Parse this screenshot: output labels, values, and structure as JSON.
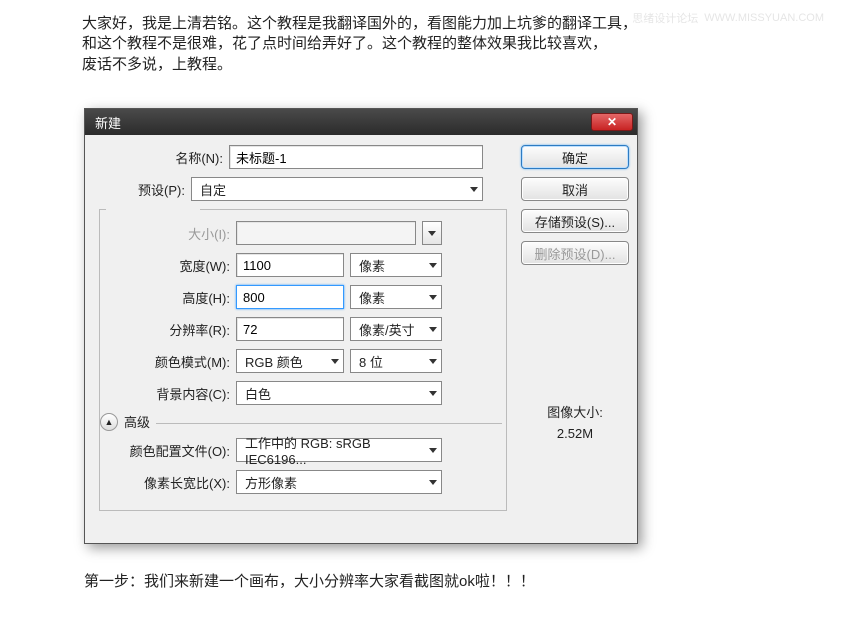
{
  "watermark": {
    "text1": "思绪设计论坛",
    "text2": "WWW.MISSYUAN.COM"
  },
  "intro": {
    "line1": "大家好，我是上清若铭。这个教程是我翻译国外的，看图能力加上坑爹的翻译工具，",
    "line2": "和这个教程不是很难，花了点时间给弄好了。这个教程的整体效果我比较喜欢，",
    "line3": "废话不多说，上教程。"
  },
  "dialog": {
    "title": "新建",
    "name_label": "名称(N):",
    "name_value": "未标题-1",
    "preset_label": "预设(P):",
    "preset_value": "自定",
    "size_label": "大小(I):",
    "size_value": "",
    "width_label": "宽度(W):",
    "width_value": "1100",
    "width_unit": "像素",
    "height_label": "高度(H):",
    "height_value": "800",
    "height_unit": "像素",
    "res_label": "分辨率(R):",
    "res_value": "72",
    "res_unit": "像素/英寸",
    "mode_label": "颜色模式(M):",
    "mode_value": "RGB 颜色",
    "depth_value": "8 位",
    "bg_label": "背景内容(C):",
    "bg_value": "白色",
    "advanced_label": "高级",
    "profile_label": "颜色配置文件(O):",
    "profile_value": "工作中的 RGB: sRGB IEC6196...",
    "aspect_label": "像素长宽比(X):",
    "aspect_value": "方形像素",
    "ok_label": "确定",
    "cancel_label": "取消",
    "save_preset_label": "存储预设(S)...",
    "delete_preset_label": "删除预设(D)...",
    "imgsize_label": "图像大小:",
    "imgsize_value": "2.52M"
  },
  "outro": "第一步：我们来新建一个画布，大小分辨率大家看截图就ok啦！！！"
}
